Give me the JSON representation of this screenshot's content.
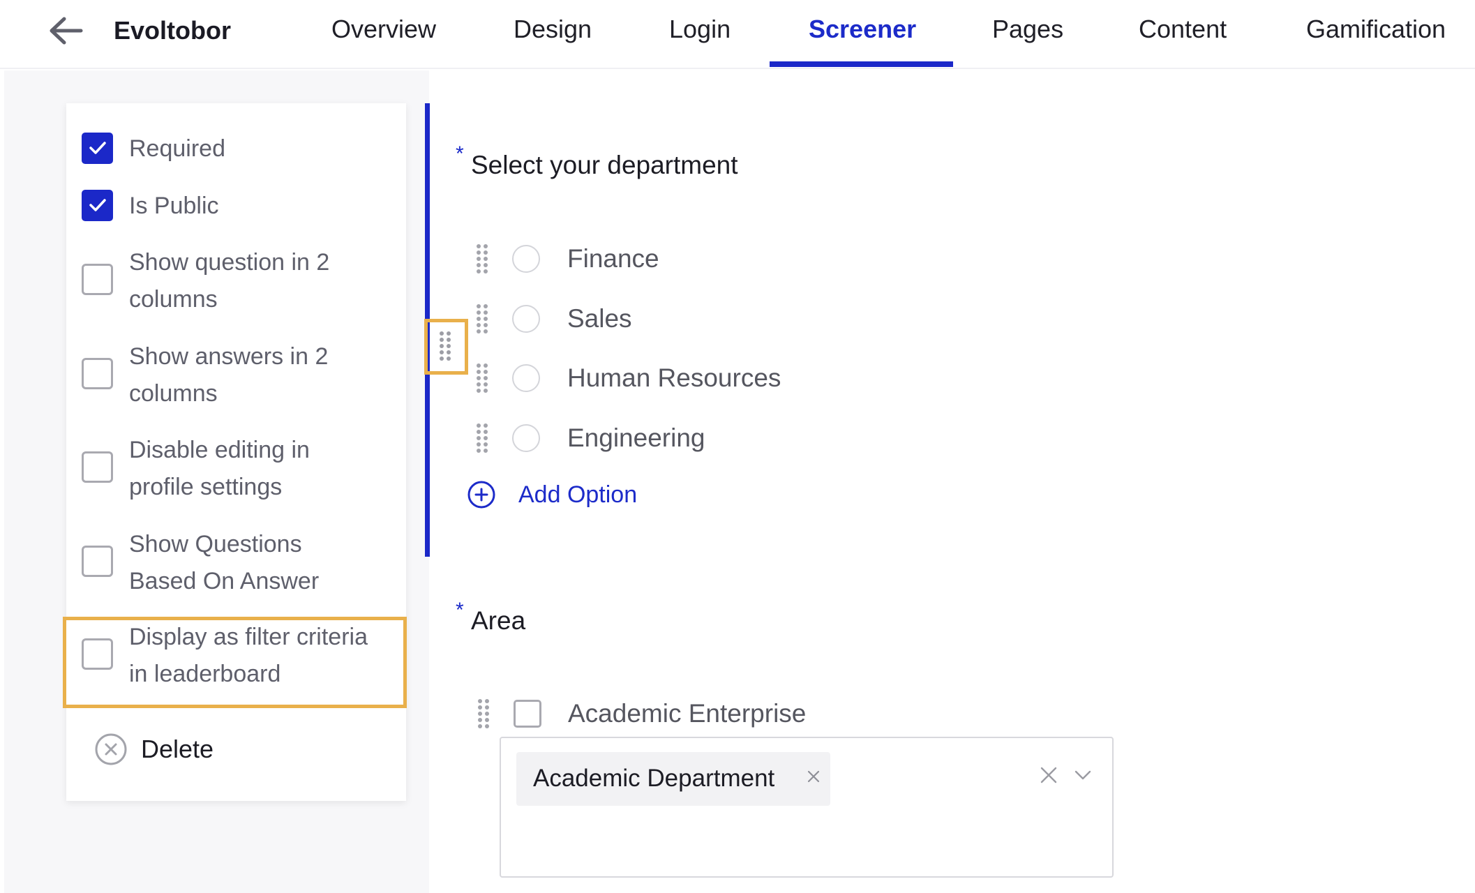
{
  "header": {
    "back_icon": "arrow-left-icon",
    "app_title": "Evoltobor",
    "tabs": [
      {
        "label": "Overview",
        "active": false
      },
      {
        "label": "Design",
        "active": false
      },
      {
        "label": "Login",
        "active": false
      },
      {
        "label": "Screener",
        "active": true
      },
      {
        "label": "Pages",
        "active": false
      },
      {
        "label": "Content",
        "active": false
      },
      {
        "label": "Gamification",
        "active": false
      }
    ]
  },
  "settings": {
    "items": [
      {
        "label": "Required",
        "checked": true
      },
      {
        "label": "Is Public",
        "checked": true
      },
      {
        "label_line1": "Show question in 2",
        "label_line2": "columns",
        "checked": false
      },
      {
        "label_line1": "Show answers in 2",
        "label_line2": "columns",
        "checked": false
      },
      {
        "label_line1": "Disable editing in",
        "label_line2": "profile settings",
        "checked": false
      },
      {
        "label_line1": "Show Questions",
        "label_line2": "Based On Answer",
        "checked": false
      },
      {
        "label_line1": "Display as filter criteria",
        "label_line2": "in leaderboard",
        "checked": false,
        "highlighted": true
      }
    ],
    "delete_label": "Delete",
    "delete_icon": "close-circle-icon"
  },
  "questions": [
    {
      "required_marker": "*",
      "title": "Select your department",
      "type": "radio",
      "options": [
        "Finance",
        "Sales",
        "Human Resources",
        "Engineering"
      ],
      "add_option_label": "Add Option",
      "add_option_icon": "plus-circle-icon"
    },
    {
      "required_marker": "*",
      "title": "Area",
      "type": "checkbox",
      "options": [
        {
          "label": "Academic Enterprise",
          "checked": false,
          "linked_select": {
            "selected_tags": [
              "Academic Department"
            ],
            "tag_remove_icon": "close-icon",
            "clear_icon": "close-icon",
            "dropdown_icon": "chevron-down-icon"
          }
        }
      ]
    }
  ],
  "colors": {
    "accent": "#1b28c8",
    "highlight": "#e9b04b",
    "panel_bg": "#f7f7f9",
    "tag_bg": "#f2f2f4",
    "muted_text": "#5e5f6b"
  }
}
